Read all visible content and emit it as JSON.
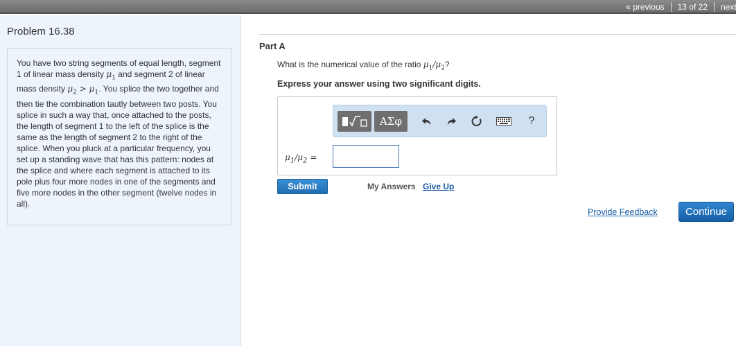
{
  "nav": {
    "previous": "« previous",
    "counter": "13 of 22",
    "next": "next"
  },
  "problem": {
    "title": "Problem 16.38",
    "text_1": "You have two string segments of equal length, segment 1 of linear mass density ",
    "text_2": " and segment 2 of linear mass density ",
    "text_3": ". You splice the two together and then tie the combination tautly between two posts. You splice in such a way that, once attached to the posts, the length of segment 1 to the left of the splice is the same as the length of segment 2 to the right of the splice. When you pluck at a particular frequency, you set up a standing wave that has this pattern: nodes at the splice and where each segment is attached to its pole plus four more nodes in one of the segments and five more nodes in the other segment (twelve nodes in all).",
    "symbols": {
      "mu": "μ",
      "sub1": "1",
      "sub2": "2",
      "gt": " > "
    }
  },
  "part": {
    "label": "Part A",
    "question": "What is the numerical value of the ratio ",
    "question_end": "?",
    "instruction": "Express your answer using two significant digits.",
    "equals": "=",
    "answer_value": ""
  },
  "toolbar": {
    "greek_label": "ΑΣφ",
    "help_label": "?",
    "icons": [
      "templates-icon",
      "greek-icon",
      "undo-icon",
      "redo-icon",
      "reset-icon",
      "keyboard-icon",
      "help-icon"
    ]
  },
  "actions": {
    "submit": "Submit",
    "my_answers": "My Answers",
    "give_up": "Give Up",
    "feedback": "Provide Feedback",
    "continue": "Continue"
  },
  "colors": {
    "link": "#1a5aa6",
    "button": "#1f6db0",
    "left_panel": "#eef4fb",
    "toolbar": "#cfe0f1"
  }
}
